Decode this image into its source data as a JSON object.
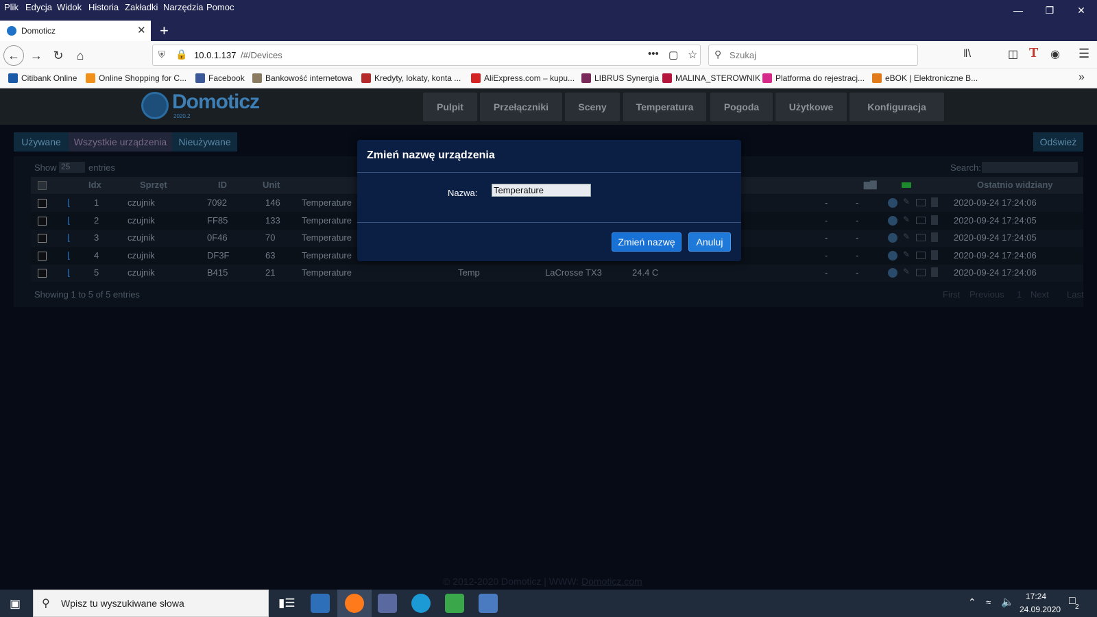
{
  "menu": [
    "Plik",
    "Edycja",
    "Widok",
    "Historia",
    "Zakładki",
    "Narzędzia",
    "Pomoc"
  ],
  "browser": {
    "tab_title": "Domoticz",
    "url_host": "10.0.1.137",
    "url_path": "/#/Devices",
    "search_placeholder": "Szukaj"
  },
  "bookmarks": [
    {
      "label": "Citibank Online",
      "icon": "citi",
      "color": "#1a5aa6"
    },
    {
      "label": "Online Shopping for C...",
      "icon": "bg",
      "color": "#f0901a"
    },
    {
      "label": "Facebook",
      "icon": "facebook",
      "color": "#3b5998"
    },
    {
      "label": "Bankowość internetowa",
      "icon": "umbrella",
      "color": "#8a7a60"
    },
    {
      "label": "Kredyty, lokaty, konta ...",
      "icon": "mbank",
      "color": "#b52a2a"
    },
    {
      "label": "AliExpress.com – kupu...",
      "icon": "aliexpress",
      "color": "#d32323"
    },
    {
      "label": "LIBRUS Synergia",
      "icon": "librus",
      "color": "#7a2a5a"
    },
    {
      "label": "MALINA_STEROWNIK",
      "icon": "raspberry",
      "color": "#b3163a"
    },
    {
      "label": "Platforma do rejestracj...",
      "icon": "platforma",
      "color": "#d62a8a"
    },
    {
      "label": "eBOK | Elektroniczne B...",
      "icon": "ebok",
      "color": "#e07a1a"
    }
  ],
  "app": {
    "logo": "Domoticz",
    "logo_year": "2020.2",
    "nav": [
      "Pulpit",
      "Przełączniki",
      "Sceny",
      "Temperatura",
      "Pogoda",
      "Użytkowe",
      "Konfiguracja"
    ],
    "subtabs": [
      "Używane",
      "Wszystkie urządzenia",
      "Nieużywane"
    ],
    "refresh": "Odśwież",
    "show_label": "Show",
    "show_value": "25",
    "entries_label": "entries",
    "search_label": "Search:",
    "columns": {
      "idx": "Idx",
      "hardware": "Sprzęt",
      "id": "ID",
      "unit": "Unit",
      "last_seen": "Ostatnio widziany"
    },
    "rows": [
      {
        "idx": "1",
        "hardware": "czujnik",
        "id": "7092",
        "unit": "146",
        "name": "Temperature",
        "type": "",
        "subtype": "",
        "data": "",
        "a": "-",
        "b": "-",
        "last": "2020-09-24 17:24:06"
      },
      {
        "idx": "2",
        "hardware": "czujnik",
        "id": "FF85",
        "unit": "133",
        "name": "Temperature",
        "type": "",
        "subtype": "",
        "data": "",
        "a": "-",
        "b": "-",
        "last": "2020-09-24 17:24:05"
      },
      {
        "idx": "3",
        "hardware": "czujnik",
        "id": "0F46",
        "unit": "70",
        "name": "Temperature",
        "type": "",
        "subtype": "",
        "data": "",
        "a": "-",
        "b": "-",
        "last": "2020-09-24 17:24:05"
      },
      {
        "idx": "4",
        "hardware": "czujnik",
        "id": "DF3F",
        "unit": "63",
        "name": "Temperature",
        "type": "",
        "subtype": "",
        "data": "",
        "a": "-",
        "b": "-",
        "last": "2020-09-24 17:24:06"
      },
      {
        "idx": "5",
        "hardware": "czujnik",
        "id": "B415",
        "unit": "21",
        "name": "Temperature",
        "type": "Temp",
        "subtype": "LaCrosse TX3",
        "data": "24.4 C",
        "a": "-",
        "b": "-",
        "last": "2020-09-24 17:24:06"
      }
    ],
    "showing": "Showing 1 to 5 of 5 entries",
    "pagination": [
      "First",
      "Previous",
      "1",
      "Next",
      "Last"
    ],
    "footer_prefix": "© 2012-2020 Domoticz | WWW:",
    "footer_link": "Domoticz.com"
  },
  "dialog": {
    "title": "Zmień nazwę urządzenia",
    "name_label": "Nazwa:",
    "name_value": "Temperature",
    "rename_button": "Zmień nazwę",
    "cancel_button": "Anuluj"
  },
  "taskbar": {
    "search_placeholder": "Wpisz tu wyszukiwane słowa",
    "time": "17:24",
    "date": "24.09.2020",
    "notifications": "2"
  }
}
